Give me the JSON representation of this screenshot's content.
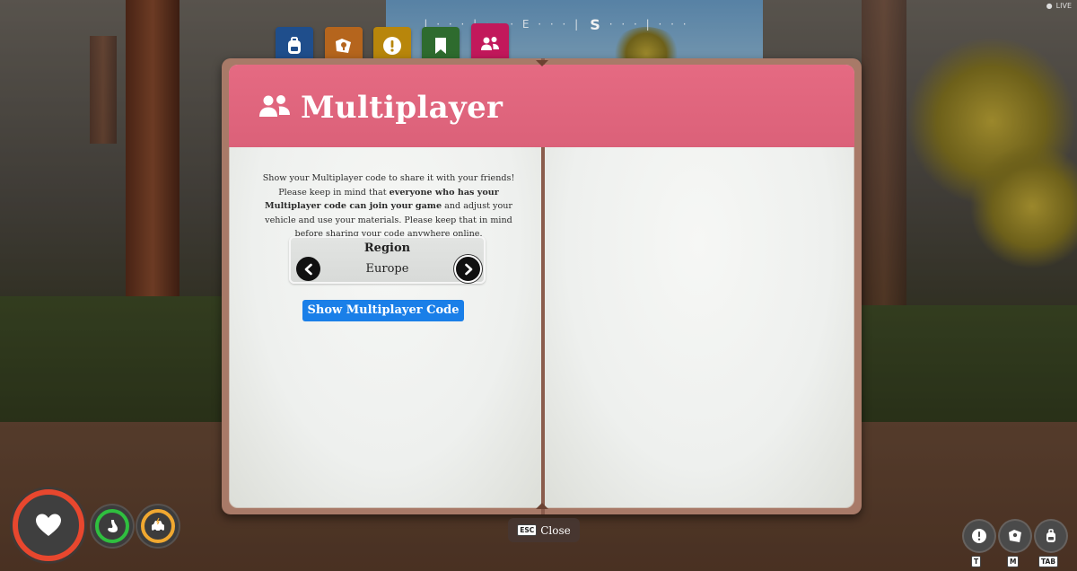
{
  "compass": {
    "ticks_left": "| · · · | · · · E · · · |",
    "direction": "S",
    "ticks_right": "· · · | · · ·"
  },
  "status": {
    "live": "LIVE"
  },
  "tabs": [
    {
      "id": "backpack",
      "icon": "backpack-icon",
      "color": "#1f4e8c"
    },
    {
      "id": "map",
      "icon": "map-icon",
      "color": "#b5651d"
    },
    {
      "id": "quests",
      "icon": "exclamation-icon",
      "color": "#b8860b"
    },
    {
      "id": "journal",
      "icon": "bookmark-icon",
      "color": "#2e6b2e"
    },
    {
      "id": "multiplayer",
      "icon": "users-icon",
      "color": "#c2185b",
      "active": true
    }
  ],
  "page": {
    "title": "Multiplayer",
    "description_1": "Show your Multiplayer code to share it with your friends! Please keep in mind that ",
    "description_bold": "everyone who has your Multiplayer code can join your game",
    "description_2": " and adjust your vehicle and use your materials. Please keep that in mind before sharing your code anywhere online."
  },
  "region": {
    "label": "Region",
    "value": "Europe"
  },
  "show_code_button": "Show Multiplayer Code",
  "close": {
    "key": "ESC",
    "label": "Close"
  },
  "hud_right": [
    {
      "icon": "exclamation-icon",
      "key": "T"
    },
    {
      "icon": "map-icon",
      "key": "M"
    },
    {
      "icon": "backpack-icon",
      "key": "TAB"
    }
  ],
  "colors": {
    "accent_band": "#e56a82",
    "button_blue": "#1a7fe8",
    "health": "#e8472e",
    "stamina": "#2fbf3f",
    "fuel": "#f0a830"
  }
}
